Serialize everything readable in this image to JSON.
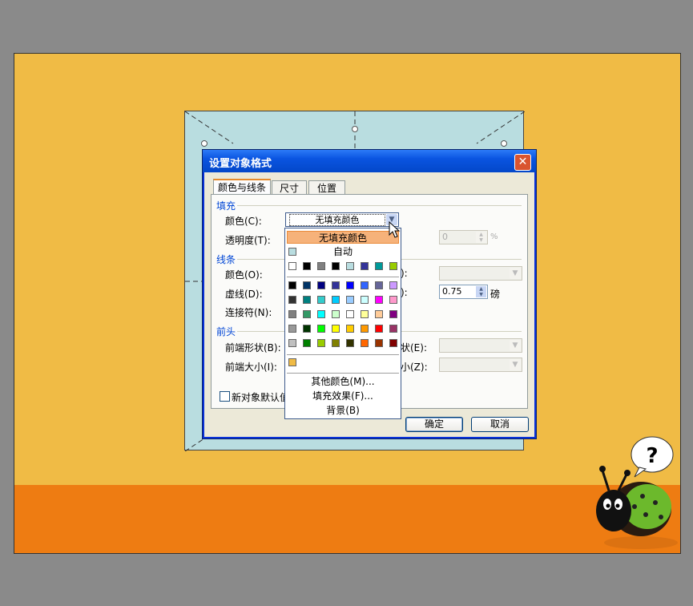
{
  "dialog": {
    "title": "设置对象格式",
    "close_glyph": "✕",
    "tabs": [
      "颜色与线条",
      "尺寸",
      "位置"
    ],
    "fill": {
      "section": "填充",
      "color_label": "颜色(C):",
      "color_value": "无填充颜色",
      "transparency_label": "透明度(T):",
      "transparency_value": "0",
      "transparency_unit": "%"
    },
    "line": {
      "section": "线条",
      "color_label": "颜色(O):",
      "dash_label": "虚线(D):",
      "connector_label": "连接符(N):",
      "weight_value": "0.75",
      "weight_unit": "磅",
      "partial_o": "):",
      "partial_w": "):"
    },
    "arrows": {
      "section": "前头",
      "begin_style_label": "前端形状(B):",
      "begin_size_label": "前端大小(I):",
      "end_style_partial": "状(E):",
      "end_size_partial": "小(Z):"
    },
    "default_checkbox_label": "新对象默认值",
    "ok_label": "确定",
    "cancel_label": "取消"
  },
  "dropdown": {
    "selected": "无填充颜色",
    "auto": "自动",
    "more_colors": "其他颜色(M)...",
    "fill_effects": "填充效果(F)...",
    "background": "背景(B)",
    "scheme_colors": [
      "#ffffff",
      "#000000",
      "#808080",
      "#000000",
      "#b9dde0",
      "#333399",
      "#009999",
      "#99cc00"
    ],
    "standard_colors": [
      [
        "#000000",
        "#003366",
        "#000080",
        "#333399",
        "#0000ff",
        "#3366ff",
        "#666699",
        "#cc99ff"
      ],
      [
        "#333333",
        "#008080",
        "#33cccc",
        "#00ccff",
        "#99ccff",
        "#ccffff",
        "#ff00ff",
        "#ff99cc"
      ],
      [
        "#808080",
        "#339966",
        "#00ffff",
        "#ccffcc",
        "#ffffff",
        "#ffff99",
        "#ffcc99",
        "#800080"
      ],
      [
        "#999999",
        "#003300",
        "#00ff00",
        "#ffff00",
        "#ffcc00",
        "#ff9900",
        "#ff0000",
        "#993366"
      ],
      [
        "#c0c0c0",
        "#008000",
        "#99cc00",
        "#808000",
        "#333300",
        "#ff6600",
        "#993300",
        "#800000"
      ]
    ],
    "recent_color": "#f0bb45"
  },
  "speech_bubble": "?"
}
